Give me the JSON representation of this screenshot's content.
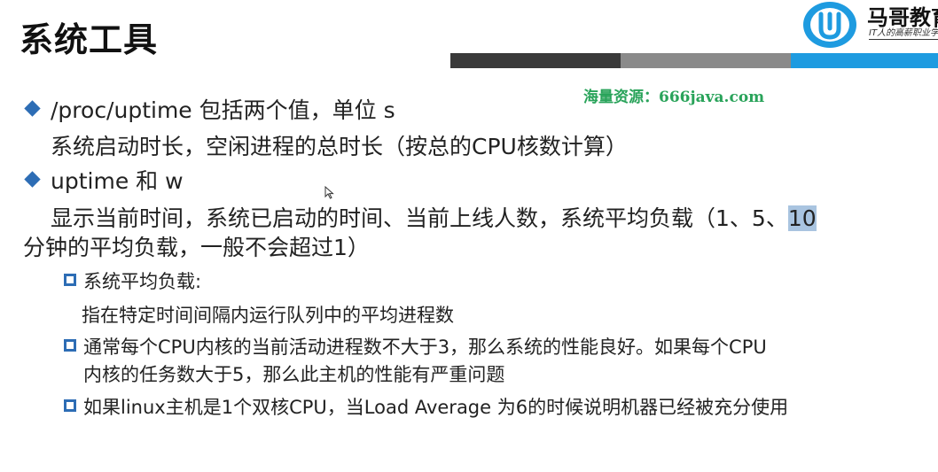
{
  "slide": {
    "title": "系统工具",
    "brand": "马哥教育",
    "slogan": "IT人的高薪职业学",
    "watermark": "海量资源：666java.com"
  },
  "bullets": [
    {
      "text": "/proc/uptime 包括两个值，单位 s"
    },
    {
      "text": "系统启动时长，空闲进程的总时长（按总的CPU核数计算）"
    },
    {
      "text": "uptime 和 w"
    },
    {
      "text_a": "显示当前时间，系统已启动的时间、当前上线人数，系统平均负载（1、5、",
      "text_highlight": "10",
      "text_b": "分钟的平均负载，一般不会超过1）"
    }
  ],
  "sub_bullets": [
    {
      "text": "系统平均负载:"
    },
    {
      "text": "指在特定时间间隔内运行队列中的平均进程数"
    },
    {
      "text_a": "通常每个CPU内核的当前活动进程数不大于3，那么系统的性能良好。如果每个CPU",
      "text_b": "内核的任务数大于5，那么此主机的性能有严重问题"
    },
    {
      "text": "如果linux主机是1个双核CPU，当Load Average 为6的时候说明机器已经被充分使用"
    }
  ],
  "colors": {
    "bullet": "#2d6db5",
    "accent_blue": "#1e9be0",
    "watermark": "#29a35a",
    "highlight": "#a9c4e0"
  },
  "icons": {
    "main_bullet": "diamond-icon",
    "sub_bullet": "hollow-square-icon",
    "logo": "brand-logo-icon",
    "cursor": "mouse-pointer-icon"
  }
}
